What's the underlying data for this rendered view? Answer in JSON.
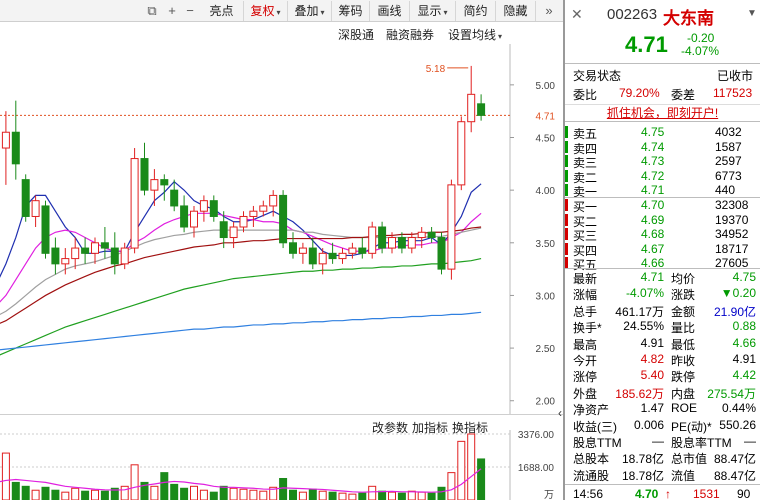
{
  "toolbar": {
    "items": [
      {
        "label": "亮点",
        "active": false,
        "arrow": false
      },
      {
        "label": "复权",
        "active": true,
        "arrow": true
      },
      {
        "label": "叠加",
        "active": false,
        "arrow": true
      },
      {
        "label": "筹码",
        "active": false,
        "arrow": false
      },
      {
        "label": "画线",
        "active": false,
        "arrow": false
      },
      {
        "label": "显示",
        "active": false,
        "arrow": true
      },
      {
        "label": "简约",
        "active": false,
        "arrow": false
      },
      {
        "label": "隐藏",
        "active": false,
        "arrow": false
      }
    ],
    "icons": [
      "copy-icon",
      "zoom-in-icon",
      "zoom-out-icon",
      "double-arrow-icon"
    ]
  },
  "subbar": {
    "shengutong": "深股通",
    "margin": "融资融券",
    "ma_settings": "设置均线"
  },
  "price_axis": {
    "ticks": [
      "5.00",
      "4.50",
      "4.00",
      "3.50",
      "3.00",
      "2.50",
      "2.00"
    ],
    "current": "4.71",
    "high_label": "5.18"
  },
  "indicator_bar": {
    "params": "改参数",
    "add": "加指标",
    "switch": "换指标"
  },
  "volume_axis": {
    "ticks": [
      "3376.00",
      "1688.00"
    ],
    "unit": "万"
  },
  "stock": {
    "code": "002263",
    "name": "大东南",
    "price": "4.71",
    "change": "-0.20",
    "pct": "-4.07%",
    "status_label": "交易状态",
    "status_value": "已收市",
    "ratio_label": "委比",
    "ratio_value": "79.20%",
    "diff_label": "委差",
    "diff_value": "117523",
    "ad_text": "抓住机会，即刻开户!"
  },
  "asks": [
    {
      "label": "卖五",
      "price": "4.75",
      "vol": "4032"
    },
    {
      "label": "卖四",
      "price": "4.74",
      "vol": "1587"
    },
    {
      "label": "卖三",
      "price": "4.73",
      "vol": "2597"
    },
    {
      "label": "卖二",
      "price": "4.72",
      "vol": "6773"
    },
    {
      "label": "卖一",
      "price": "4.71",
      "vol": "440"
    }
  ],
  "bids": [
    {
      "label": "买一",
      "price": "4.70",
      "vol": "32308"
    },
    {
      "label": "买二",
      "price": "4.69",
      "vol": "19370"
    },
    {
      "label": "买三",
      "price": "4.68",
      "vol": "34952"
    },
    {
      "label": "买四",
      "price": "4.67",
      "vol": "18717"
    },
    {
      "label": "买五",
      "price": "4.66",
      "vol": "27605"
    }
  ],
  "stats": [
    {
      "l1": "最新",
      "v1": "4.71",
      "c1": "green",
      "l2": "均价",
      "v2": "4.75",
      "c2": "green"
    },
    {
      "l1": "涨幅",
      "v1": "-4.07%",
      "c1": "green",
      "l2": "涨跌",
      "v2": "▼0.20",
      "c2": "green"
    },
    {
      "l1": "总手",
      "v1": "461.17万",
      "c1": "dark",
      "l2": "金额",
      "v2": "21.90亿",
      "c2": "blue"
    },
    {
      "l1": "换手*",
      "v1": "24.55%",
      "c1": "dark",
      "l2": "量比",
      "v2": "0.88",
      "c2": "green"
    },
    {
      "l1": "最高",
      "v1": "4.91",
      "c1": "dark",
      "l2": "最低",
      "v2": "4.66",
      "c2": "green"
    },
    {
      "l1": "今开",
      "v1": "4.82",
      "c1": "red",
      "l2": "昨收",
      "v2": "4.91",
      "c2": "dark"
    },
    {
      "l1": "涨停",
      "v1": "5.40",
      "c1": "red",
      "l2": "跌停",
      "v2": "4.42",
      "c2": "green"
    },
    {
      "l1": "外盘",
      "v1": "185.62万",
      "c1": "red",
      "l2": "内盘",
      "v2": "275.54万",
      "c2": "green"
    },
    {
      "l1": "净资产",
      "v1": "1.47",
      "c1": "dark",
      "l2": "ROE",
      "v2": "0.44%",
      "c2": "dark"
    },
    {
      "l1": "收益(三)",
      "v1": "0.006",
      "c1": "dark",
      "l2": "PE(动)*",
      "v2": "550.26",
      "c2": "dark"
    },
    {
      "l1": "股息TTM",
      "v1": "—",
      "c1": "dark",
      "l2": "股息率TTM",
      "v2": "—",
      "c2": "dark"
    },
    {
      "l1": "总股本",
      "v1": "18.78亿",
      "c1": "dark",
      "l2": "总市值",
      "v2": "88.47亿",
      "c2": "dark"
    },
    {
      "l1": "流通股",
      "v1": "18.78亿",
      "c1": "dark",
      "l2": "流值",
      "v2": "88.47亿",
      "c2": "dark"
    }
  ],
  "last_trade": {
    "time": "14:56",
    "price": "4.70",
    "arrow": "↑",
    "vol": "1531",
    "count": "90"
  },
  "chart_data": {
    "type": "candlestick",
    "candles": [
      [
        4.3,
        4.45,
        3.85,
        3.95
      ],
      [
        4.4,
        4.75,
        4.05,
        4.55
      ],
      [
        4.55,
        4.85,
        4.1,
        4.25
      ],
      [
        4.1,
        4.15,
        3.7,
        3.75
      ],
      [
        3.75,
        3.95,
        3.65,
        3.9
      ],
      [
        3.85,
        3.9,
        3.35,
        3.4
      ],
      [
        3.45,
        3.55,
        3.2,
        3.3
      ],
      [
        3.3,
        3.45,
        3.2,
        3.35
      ],
      [
        3.35,
        3.55,
        3.25,
        3.45
      ],
      [
        3.45,
        3.55,
        3.3,
        3.4
      ],
      [
        3.4,
        3.55,
        3.3,
        3.5
      ],
      [
        3.5,
        3.65,
        3.35,
        3.45
      ],
      [
        3.45,
        3.6,
        3.2,
        3.3
      ],
      [
        3.3,
        3.5,
        3.25,
        3.45
      ],
      [
        3.45,
        4.4,
        3.4,
        4.3
      ],
      [
        4.3,
        4.45,
        3.95,
        4.0
      ],
      [
        4.0,
        4.2,
        3.85,
        4.1
      ],
      [
        4.1,
        4.15,
        3.9,
        4.05
      ],
      [
        4.0,
        4.1,
        3.8,
        3.85
      ],
      [
        3.85,
        3.95,
        3.6,
        3.65
      ],
      [
        3.65,
        3.85,
        3.55,
        3.8
      ],
      [
        3.8,
        3.95,
        3.7,
        3.9
      ],
      [
        3.9,
        3.95,
        3.7,
        3.75
      ],
      [
        3.7,
        3.8,
        3.45,
        3.55
      ],
      [
        3.55,
        3.7,
        3.45,
        3.65
      ],
      [
        3.65,
        3.8,
        3.6,
        3.75
      ],
      [
        3.75,
        3.85,
        3.65,
        3.8
      ],
      [
        3.8,
        3.9,
        3.75,
        3.85
      ],
      [
        3.85,
        4.0,
        3.75,
        3.95
      ],
      [
        3.95,
        4.0,
        3.45,
        3.5
      ],
      [
        3.5,
        3.6,
        3.35,
        3.4
      ],
      [
        3.4,
        3.5,
        3.3,
        3.45
      ],
      [
        3.45,
        3.55,
        3.25,
        3.3
      ],
      [
        3.3,
        3.45,
        3.2,
        3.4
      ],
      [
        3.4,
        3.5,
        3.3,
        3.35
      ],
      [
        3.35,
        3.45,
        3.3,
        3.4
      ],
      [
        3.4,
        3.5,
        3.35,
        3.45
      ],
      [
        3.45,
        3.55,
        3.35,
        3.4
      ],
      [
        3.4,
        3.7,
        3.35,
        3.65
      ],
      [
        3.65,
        3.7,
        3.4,
        3.45
      ],
      [
        3.45,
        3.6,
        3.4,
        3.55
      ],
      [
        3.55,
        3.6,
        3.4,
        3.45
      ],
      [
        3.45,
        3.6,
        3.4,
        3.55
      ],
      [
        3.55,
        3.65,
        3.45,
        3.6
      ],
      [
        3.6,
        3.65,
        3.5,
        3.55
      ],
      [
        3.55,
        3.6,
        3.2,
        3.25
      ],
      [
        3.25,
        4.1,
        3.15,
        4.05
      ],
      [
        4.05,
        4.7,
        4.0,
        4.65
      ],
      [
        4.65,
        5.18,
        4.55,
        4.91
      ],
      [
        4.82,
        4.91,
        4.66,
        4.71
      ]
    ],
    "ma": [
      {
        "name": "MA5",
        "color": "#1f2fb0",
        "values": [
          3.1,
          3.3,
          3.55,
          3.85,
          3.95,
          3.95,
          3.8,
          3.65,
          3.55,
          3.4,
          3.4,
          3.42,
          3.42,
          3.42,
          3.6,
          3.75,
          3.9,
          3.98,
          4.08,
          4.0,
          3.9,
          3.85,
          3.82,
          3.75,
          3.7,
          3.7,
          3.72,
          3.76,
          3.8,
          3.75,
          3.7,
          3.62,
          3.52,
          3.42,
          3.38,
          3.38,
          3.38,
          3.4,
          3.45,
          3.5,
          3.5,
          3.52,
          3.52,
          3.52,
          3.55,
          3.48,
          3.6,
          3.75,
          3.98,
          4.06
        ]
      },
      {
        "name": "MA10",
        "color": "#e020e0",
        "values": [
          2.9,
          3.0,
          3.15,
          3.3,
          3.45,
          3.55,
          3.6,
          3.62,
          3.6,
          3.55,
          3.5,
          3.45,
          3.42,
          3.42,
          3.5,
          3.55,
          3.62,
          3.68,
          3.72,
          3.75,
          3.78,
          3.78,
          3.78,
          3.76,
          3.74,
          3.72,
          3.72,
          3.7,
          3.7,
          3.68,
          3.62,
          3.6,
          3.56,
          3.52,
          3.48,
          3.45,
          3.42,
          3.42,
          3.42,
          3.45,
          3.45,
          3.47,
          3.48,
          3.48,
          3.5,
          3.5,
          3.55,
          3.6,
          3.7,
          3.78
        ]
      },
      {
        "name": "MA20",
        "color": "#a0a0a0",
        "values": [
          2.8,
          2.85,
          2.92,
          3.0,
          3.08,
          3.15,
          3.2,
          3.25,
          3.28,
          3.3,
          3.32,
          3.35,
          3.38,
          3.42,
          3.46,
          3.5,
          3.53,
          3.55,
          3.57,
          3.58,
          3.6,
          3.61,
          3.62,
          3.62,
          3.62,
          3.62,
          3.62,
          3.62,
          3.62,
          3.62,
          3.62,
          3.6,
          3.6,
          3.58,
          3.57,
          3.56,
          3.55,
          3.55,
          3.55,
          3.55,
          3.55,
          3.55,
          3.55,
          3.55,
          3.56,
          3.56,
          3.58,
          3.6,
          3.62,
          3.64
        ]
      },
      {
        "name": "MA30",
        "color": "#a01010",
        "values": [
          2.72,
          2.76,
          2.82,
          2.88,
          2.94,
          3.0,
          3.05,
          3.1,
          3.14,
          3.18,
          3.22,
          3.25,
          3.28,
          3.3,
          3.33,
          3.36,
          3.38,
          3.4,
          3.42,
          3.44,
          3.46,
          3.47,
          3.48,
          3.5,
          3.5,
          3.51,
          3.52,
          3.52,
          3.53,
          3.54,
          3.54,
          3.54,
          3.54,
          3.54,
          3.54,
          3.54,
          3.55,
          3.55,
          3.56,
          3.57,
          3.57,
          3.58,
          3.58,
          3.59,
          3.6,
          3.6,
          3.61,
          3.62,
          3.64,
          3.65
        ]
      },
      {
        "name": "MA60",
        "color": "#20a020",
        "values": [
          2.42,
          2.46,
          2.5,
          2.54,
          2.58,
          2.62,
          2.66,
          2.7,
          2.73,
          2.76,
          2.79,
          2.82,
          2.85,
          2.88,
          2.91,
          2.94,
          2.97,
          3.0,
          3.03,
          3.06,
          3.08,
          3.1,
          3.12,
          3.14,
          3.16,
          3.17,
          3.18,
          3.19,
          3.2,
          3.21,
          3.22,
          3.23,
          3.23,
          3.24,
          3.24,
          3.25,
          3.25,
          3.26,
          3.26,
          3.27,
          3.27,
          3.28,
          3.28,
          3.29,
          3.3,
          3.3,
          3.31,
          3.32,
          3.33,
          3.35
        ]
      },
      {
        "name": "MA120",
        "color": "#3080e0",
        "values": [
          2.48,
          2.49,
          2.5,
          2.51,
          2.52,
          2.53,
          2.54,
          2.55,
          2.56,
          2.57,
          2.58,
          2.59,
          2.6,
          2.61,
          2.62,
          2.63,
          2.64,
          2.65,
          2.66,
          2.67,
          2.68,
          2.68,
          2.69,
          2.7,
          2.7,
          2.71,
          2.72,
          2.72,
          2.73,
          2.73,
          2.74,
          2.74,
          2.75,
          2.75,
          2.76,
          2.76,
          2.77,
          2.77,
          2.78,
          2.78,
          2.79,
          2.79,
          2.8,
          2.8,
          2.81,
          2.81,
          2.82,
          2.82,
          2.83,
          2.84
        ]
      }
    ],
    "volume": [
      1100,
      2400,
      900,
      700,
      500,
      650,
      500,
      400,
      600,
      450,
      500,
      450,
      600,
      700,
      1800,
      900,
      700,
      1400,
      800,
      600,
      700,
      500,
      400,
      700,
      600,
      550,
      500,
      450,
      650,
      1100,
      500,
      400,
      550,
      450,
      400,
      350,
      300,
      350,
      700,
      450,
      400,
      350,
      450,
      400,
      350,
      650,
      1400,
      3000,
      3376,
      2100
    ],
    "vol_ma": [
      900,
      1000,
      1050,
      1000,
      950,
      900,
      800,
      700,
      650,
      600,
      550,
      520,
      510,
      520,
      650,
      750,
      820,
      900,
      950,
      920,
      850,
      800,
      700,
      650,
      650,
      620,
      600,
      560,
      550,
      620,
      600,
      580,
      560,
      540,
      500,
      460,
      420,
      400,
      420,
      430,
      440,
      420,
      420,
      410,
      400,
      420,
      520,
      800,
      1200,
      1600
    ],
    "ylim": [
      1.95,
      5.35
    ],
    "vol_max": 3376
  }
}
